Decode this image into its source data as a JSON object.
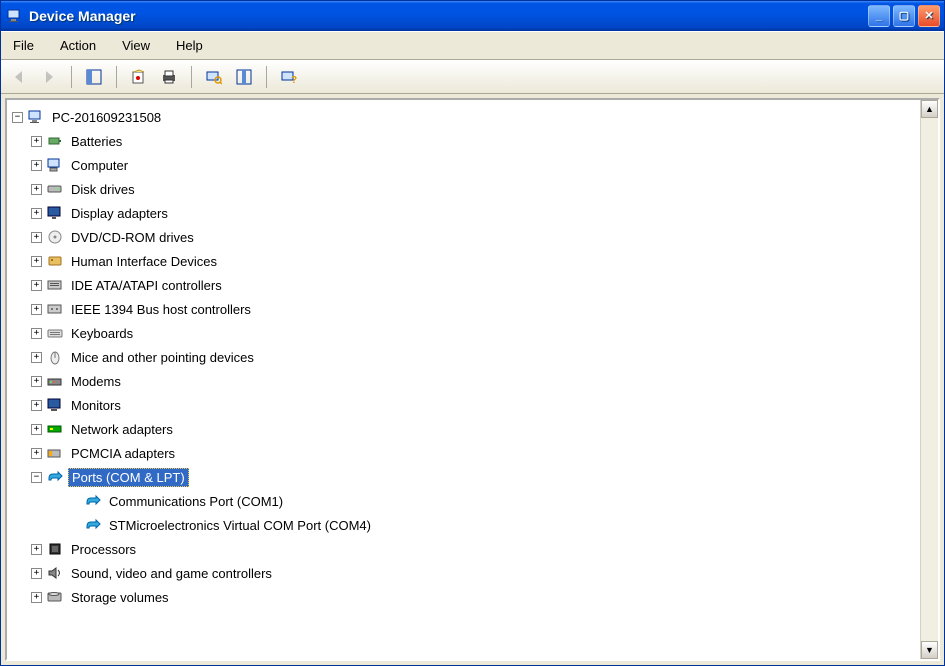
{
  "window": {
    "title": "Device Manager"
  },
  "menubar": [
    "File",
    "Action",
    "View",
    "Help"
  ],
  "toolbar_icons": [
    "back",
    "forward",
    "properties-pane",
    "properties",
    "print",
    "scan",
    "show-hidden",
    "help-context"
  ],
  "tree": {
    "root": {
      "label": "PC-201609231508",
      "expanded": true
    },
    "items": [
      {
        "label": "Batteries",
        "expanded": false,
        "icon": "battery"
      },
      {
        "label": "Computer",
        "expanded": false,
        "icon": "computer"
      },
      {
        "label": "Disk drives",
        "expanded": false,
        "icon": "diskdrive"
      },
      {
        "label": "Display adapters",
        "expanded": false,
        "icon": "display"
      },
      {
        "label": "DVD/CD-ROM drives",
        "expanded": false,
        "icon": "dvd"
      },
      {
        "label": "Human Interface Devices",
        "expanded": false,
        "icon": "hid"
      },
      {
        "label": "IDE ATA/ATAPI controllers",
        "expanded": false,
        "icon": "ide"
      },
      {
        "label": "IEEE 1394 Bus host controllers",
        "expanded": false,
        "icon": "1394"
      },
      {
        "label": "Keyboards",
        "expanded": false,
        "icon": "keyboard"
      },
      {
        "label": "Mice and other pointing devices",
        "expanded": false,
        "icon": "mouse"
      },
      {
        "label": "Modems",
        "expanded": false,
        "icon": "modem"
      },
      {
        "label": "Monitors",
        "expanded": false,
        "icon": "monitor"
      },
      {
        "label": "Network adapters",
        "expanded": false,
        "icon": "network"
      },
      {
        "label": "PCMCIA adapters",
        "expanded": false,
        "icon": "pcmcia"
      },
      {
        "label": "Ports (COM & LPT)",
        "expanded": true,
        "icon": "ports",
        "selected": true,
        "children": [
          {
            "label": "Communications Port (COM1)",
            "icon": "port"
          },
          {
            "label": "STMicroelectronics Virtual COM Port (COM4)",
            "icon": "port"
          }
        ]
      },
      {
        "label": "Processors",
        "expanded": false,
        "icon": "cpu"
      },
      {
        "label": "Sound, video and game controllers",
        "expanded": false,
        "icon": "sound"
      },
      {
        "label": "Storage volumes",
        "expanded": false,
        "icon": "storage"
      }
    ]
  }
}
